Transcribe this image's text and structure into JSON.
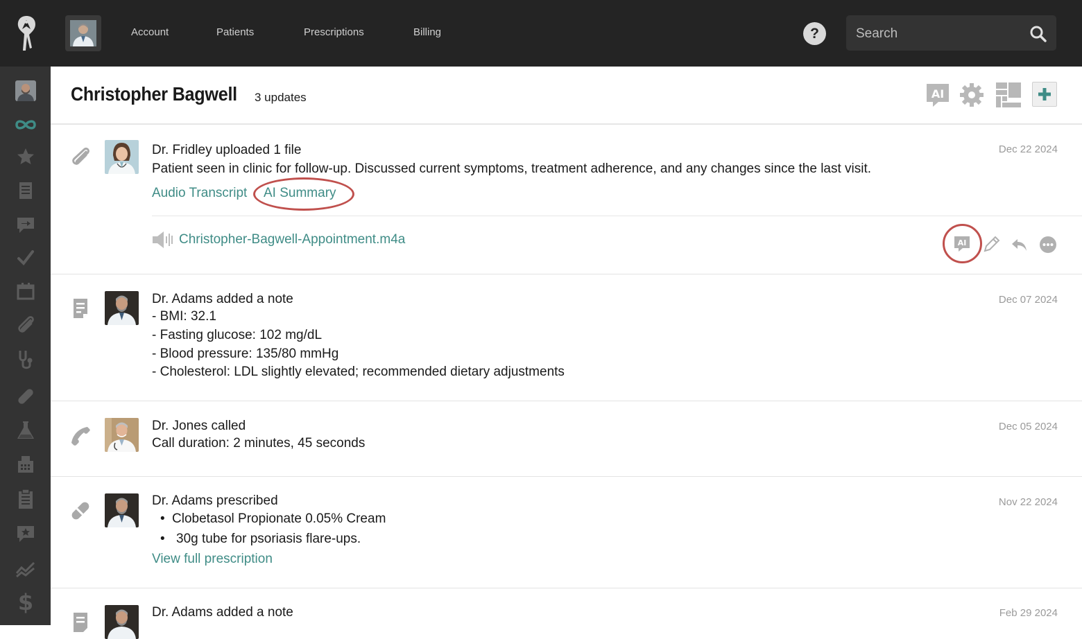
{
  "nav": {
    "links": [
      "Account",
      "Patients",
      "Prescriptions",
      "Billing"
    ],
    "help_label": "?",
    "search_placeholder": "Search"
  },
  "sidebar": {
    "items": [
      "avatar",
      "infinity-icon",
      "star-icon",
      "document-icon",
      "message-icon",
      "check-icon",
      "calendar-icon",
      "paperclip-icon",
      "stethoscope-icon",
      "pill-icon",
      "flask-icon",
      "fax-icon",
      "clipboard-icon",
      "review-icon",
      "chart-icon",
      "dollar-icon"
    ]
  },
  "header": {
    "patient_name": "Christopher Bagwell",
    "updates": "3 updates"
  },
  "colors": {
    "accent": "#3f8c86",
    "highlight": "#c0504d",
    "topbar": "#242424",
    "sidebar": "#333333"
  },
  "entries": [
    {
      "title": "Dr. Fridley uploaded 1 file",
      "date": "Dec 22 2024",
      "body": "Patient seen in clinic for follow-up. Discussed current symptoms, treatment adherence, and any changes since the last visit.",
      "links": [
        "Audio Transcript",
        "AI Summary"
      ],
      "file": "Christopher-Bagwell-Appointment.m4a"
    },
    {
      "title": "Dr. Adams added a note",
      "date": "Dec 07 2024",
      "lines": [
        "- BMI: 32.1",
        "- Fasting glucose: 102 mg/dL",
        "- Blood pressure: 135/80 mmHg",
        "- Cholesterol: LDL slightly elevated; recommended dietary adjustments"
      ]
    },
    {
      "title": "Dr. Jones called",
      "date": "Dec 05 2024",
      "lines": [
        "Call duration: 2 minutes, 45 seconds"
      ]
    },
    {
      "title": "Dr. Adams prescribed",
      "date": "Nov 22 2024",
      "bullets": [
        "Clobetasol Propionate 0.05% Cream",
        "30g tube for psoriasis flare-ups."
      ],
      "link": "View full prescription"
    },
    {
      "title": "Dr. Adams added a note",
      "date": "Feb 29 2024"
    }
  ]
}
